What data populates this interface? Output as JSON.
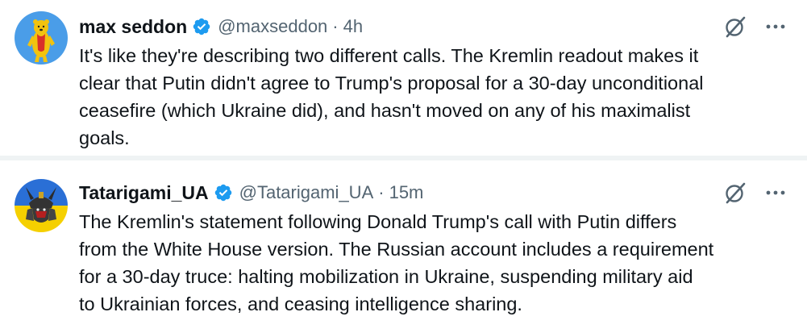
{
  "tweets": [
    {
      "display_name": "max seddon",
      "handle": "@maxseddon",
      "separator": "·",
      "time": "4h",
      "lines": [
        "It's like they're describing two different calls. The Kremlin readout makes it",
        "clear that Putin didn't agree to Trump's proposal for a 30-day unconditional",
        "ceasefire (which Ukraine did), and hasn't moved on any of his maximalist",
        "goals."
      ],
      "avatar_icon": "yellow-bear-avatar",
      "avatar_bg": "#4a9de8"
    },
    {
      "display_name": "Tatarigami_UA",
      "handle": "@Tatarigami_UA",
      "separator": "·",
      "time": "15m",
      "lines": [
        "The Kremlin's statement following Donald Trump's call with Putin differs",
        "from the White House version. The Russian account includes a requirement",
        "for a 30-day truce: halting mobilization in Ukraine, suspending military aid",
        "to Ukrainian forces, and ceasing intelligence sharing."
      ],
      "avatar_icon": "samurai-helmet-avatar",
      "avatar_bg": "#1f5fbf"
    }
  ],
  "icons": {
    "verified": "verified-badge-icon",
    "grok": "grok-icon",
    "more": "more-options-icon"
  },
  "colors": {
    "verified_blue": "#1d9bf0",
    "secondary_text": "#536471",
    "separator": "#eff3f4"
  }
}
